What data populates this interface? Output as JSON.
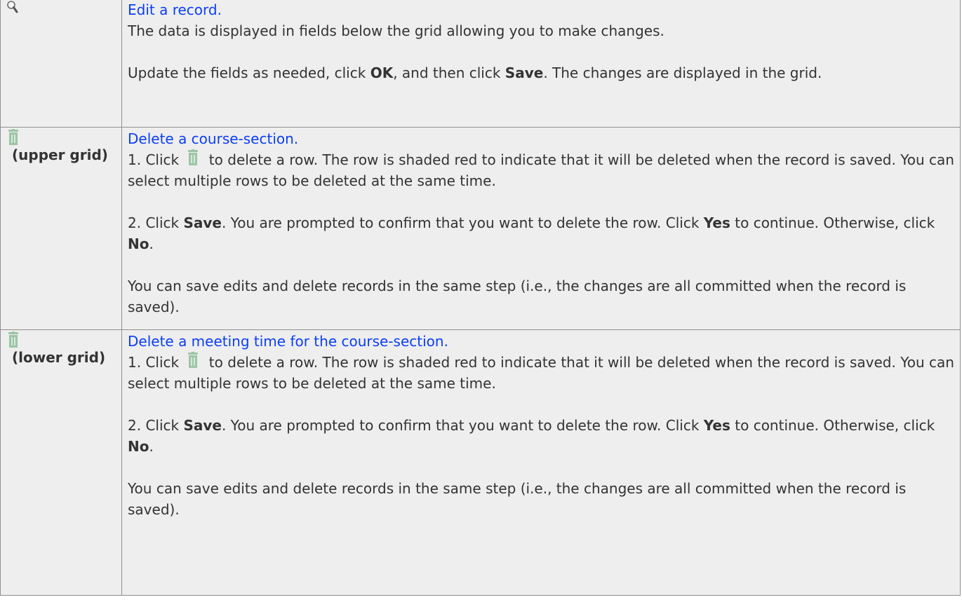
{
  "rows": [
    {
      "icon": "magnifier-icon",
      "link": "Edit a record.",
      "line1": "The data is displayed in fields below the grid allowing you to make changes.",
      "p2": [
        "Update the fields as needed, click ",
        "OK",
        ", and then click ",
        "Save",
        ". The changes are displayed in the grid."
      ]
    },
    {
      "icon": "trash-icon",
      "label": "(upper grid)",
      "link": "Delete a course-section.",
      "p1": [
        "1. Click ",
        " to delete a row. The row is shaded red to indicate that it will be deleted when the record is saved. You can select multiple rows to be deleted at the same time."
      ],
      "p2": [
        "2. Click ",
        "Save",
        ". You are prompted to confirm that you want to delete the row. Click ",
        "Yes",
        " to continue. Otherwise, click ",
        "No",
        "."
      ],
      "p3": "You can save edits and delete records in the same step (i.e., the changes are all committed when the record is saved)."
    },
    {
      "icon": "trash-icon",
      "label": "(lower grid)",
      "link": "Delete a meeting time for the course-section.",
      "p1": [
        "1. Click ",
        " to delete a row. The row is shaded red to indicate that it will be deleted when the record is saved. You can select multiple rows to be deleted at the same time."
      ],
      "p2": [
        "2. Click ",
        "Save",
        ". You are prompted to confirm that you want to delete the row. Click ",
        "Yes",
        " to continue. Otherwise, click ",
        "No",
        "."
      ],
      "p3": "You can save edits and delete records in the same step (i.e., the changes are all committed when the record is saved)."
    }
  ],
  "colors": {
    "link": "#0b3ef5",
    "cell_bg": "#eeeeee",
    "border": "#8f8f8f",
    "trash": "#9cc5a4"
  }
}
